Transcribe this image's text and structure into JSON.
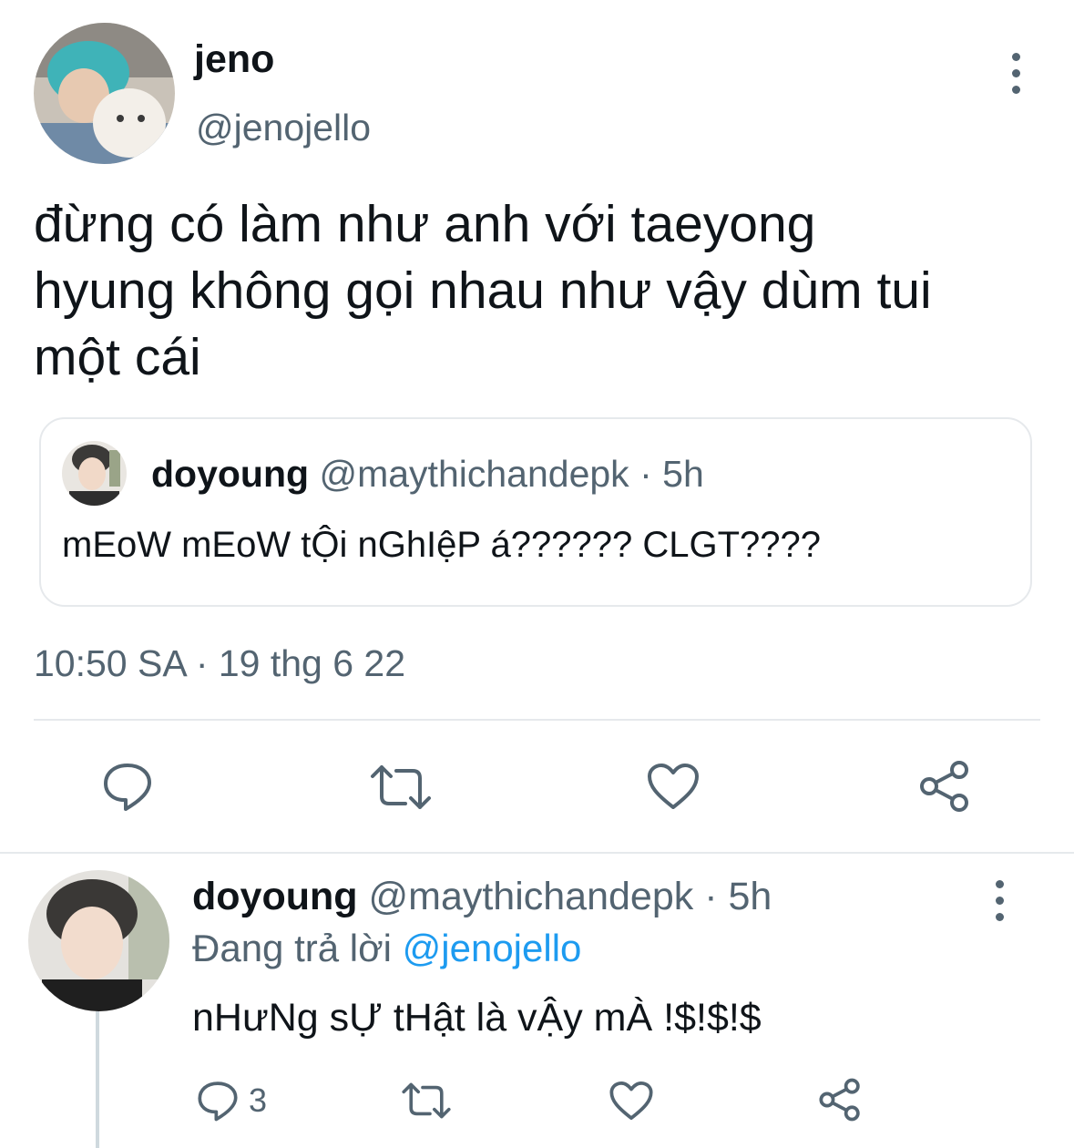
{
  "main_tweet": {
    "author_name": "jeno",
    "author_handle": "@jenojello",
    "text_line1": "đừng có làm như anh với taeyong",
    "text_line2": "hyung không gọi nhau như vậy dùm tui",
    "text_line3": "một cái",
    "timestamp": "10:50 SA · 19 thg 6 22",
    "avatar_icon": "avatar-image-icon"
  },
  "quoted_tweet": {
    "author_name": "doyoung",
    "author_handle": "@maythichandepk",
    "time": "· 5h",
    "text": "mEoW mEoW tỘi nGhIệP á?????? CLGT????"
  },
  "actions": {
    "reply_icon": "reply-icon",
    "retweet_icon": "retweet-icon",
    "like_icon": "heart-icon",
    "share_icon": "share-icon"
  },
  "reply_tweet": {
    "author_name": "doyoung",
    "author_handle": "@maythichandepk",
    "time": "· 5h",
    "replying_to_prefix": "Đang trả lời",
    "replying_to_handle": "@jenojello",
    "text": "nHưNg sỰ tHật là vẬy mÀ !$!$!$",
    "reply_count": "3"
  },
  "colors": {
    "text": "#0f1419",
    "muted": "#536471",
    "accent": "#1d9bf0",
    "divider": "#e6e9ec"
  }
}
